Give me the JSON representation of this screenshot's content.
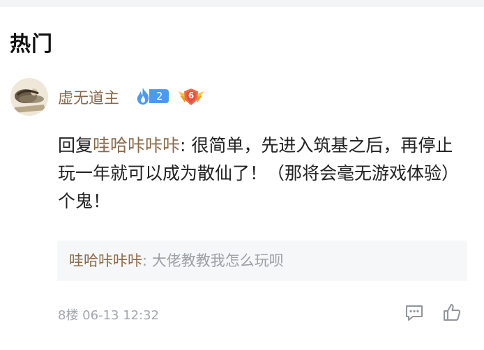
{
  "section": {
    "title": "热门"
  },
  "comment": {
    "username": "虚无道主",
    "level": "2",
    "rank": "6",
    "reply_prefix": "回复",
    "reply_to": "哇哈咔咔咔",
    "content_body": ": 很简单，先进入筑基之后，再停止玩一年就可以成为散仙了！（那将会毫无游戏体验）个鬼！",
    "quote": {
      "user": "哇哈咔咔咔",
      "text": ": 大佬教教我怎么玩呗"
    },
    "meta": "8楼 06-13 12:32"
  },
  "icons": {
    "avatar": "avatar-image",
    "level": "flame-icon",
    "rank": "winged-badge-icon",
    "reply": "comment-icon",
    "like": "thumbs-up-icon"
  },
  "colors": {
    "username": "#8a6a4a",
    "level_badge": "#4a9af0",
    "rank_badge": "#f0a020",
    "meta": "#a3a7ad",
    "quote_bg": "#f6f7f8"
  }
}
